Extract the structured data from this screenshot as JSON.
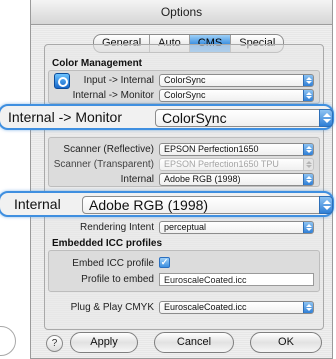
{
  "window": {
    "title": "Options"
  },
  "tabs": [
    {
      "label": "General",
      "active": false
    },
    {
      "label": "Auto",
      "active": false
    },
    {
      "label": "CMS",
      "active": true
    },
    {
      "label": "Special",
      "active": false
    }
  ],
  "color_management": {
    "heading": "Color Management",
    "input_internal": {
      "label": "Input -> Internal",
      "value": "ColorSync"
    },
    "internal_monitor": {
      "label": "Internal -> Monitor",
      "value": "ColorSync"
    }
  },
  "zoom_monitor": {
    "label": "Internal -> Monitor",
    "value": "ColorSync"
  },
  "scanners": {
    "reflective": {
      "label": "Scanner (Reflective)",
      "value": "EPSON Perfection1650"
    },
    "transparent": {
      "label": "Scanner (Transparent)",
      "value": "EPSON Perfection1650 TPU"
    },
    "internal": {
      "label": "Internal",
      "value": "Adobe RGB (1998)"
    }
  },
  "zoom_internal": {
    "label": "Internal",
    "value": "Adobe RGB (1998)"
  },
  "rendering": {
    "label": "Rendering Intent",
    "value": "perceptual"
  },
  "embedded": {
    "heading": "Embedded ICC profiles",
    "embed_label": "Embed ICC profile",
    "embed_checked": "✓",
    "profile_label": "Profile to embed",
    "profile_value": "EuroscaleCoated.icc"
  },
  "plug_play": {
    "label": "Plug & Play CMYK",
    "value": "EuroscaleCoated.icc"
  },
  "buttons": {
    "help": "?",
    "apply": "Apply",
    "cancel": "Cancel",
    "ok": "OK"
  },
  "colors": {
    "accent": "#3b8fe0",
    "zoom_border": "#3f8fe0"
  }
}
